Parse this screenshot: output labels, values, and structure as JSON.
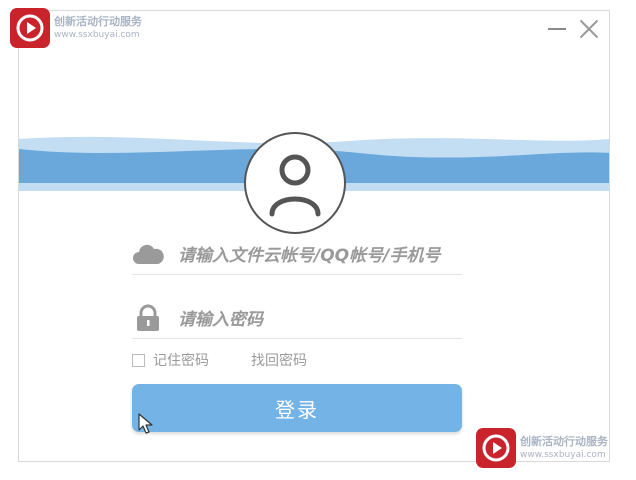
{
  "window": {
    "colors": {
      "accent": "#74b3e5",
      "wave_light": "#c3def2",
      "wave_dark": "#6aa8dc"
    }
  },
  "watermark": {
    "title": "创新活动行动服务",
    "url": "www.ssxbuyai.com"
  },
  "login": {
    "username_placeholder": "请输入文件云帐号/QQ帐号/手机号",
    "password_placeholder": "请输入密码",
    "remember_label": "记住密码",
    "forgot_label": "找回密码",
    "submit_label": "登录"
  },
  "icons": {
    "avatar": "user-avatar-icon",
    "cloud": "cloud-icon",
    "lock": "lock-icon",
    "minimize": "minimize-icon",
    "close": "close-icon",
    "cursor": "mouse-pointer-icon"
  }
}
